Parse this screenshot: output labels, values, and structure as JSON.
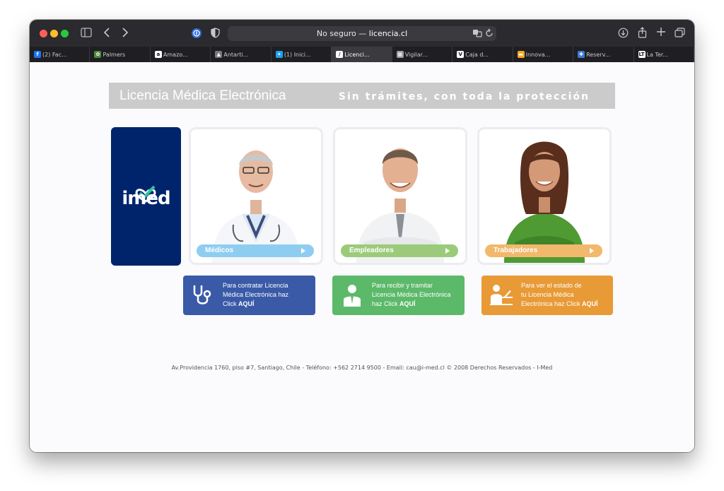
{
  "browser": {
    "address": {
      "prefix": "No seguro — ",
      "domain": "licencia.cl"
    },
    "tabs": [
      {
        "label": "(2) Fac...",
        "icon": "facebook-icon",
        "color": "#1877f2",
        "glyph": "f"
      },
      {
        "label": "Palmers",
        "icon": "palmers-icon",
        "color": "#4a8a3c",
        "glyph": "✿"
      },
      {
        "label": "Amazo...",
        "icon": "amazon-icon",
        "color": "#ffffff",
        "glyph": "a"
      },
      {
        "label": "Antarti...",
        "icon": "antartica-icon",
        "color": "#7a7a7a",
        "glyph": "▲"
      },
      {
        "label": "(1) Inici...",
        "icon": "twitter-icon",
        "color": "#1da1f2",
        "glyph": "✦"
      },
      {
        "label": "Licenci...",
        "icon": "licencia-icon",
        "color": "#ffffff",
        "glyph": "/"
      },
      {
        "label": "Vigilar...",
        "icon": "vigilar-icon",
        "color": "#9b9b9b",
        "glyph": "▦"
      },
      {
        "label": "Caja d...",
        "icon": "vimeo-icon",
        "color": "#ffffff",
        "glyph": "V"
      },
      {
        "label": "Innova...",
        "icon": "innova-icon",
        "color": "#f5a623",
        "glyph": "▬"
      },
      {
        "label": "Reserv...",
        "icon": "reserva-icon",
        "color": "#3b7bd6",
        "glyph": "✚"
      },
      {
        "label": "La Ter...",
        "icon": "laterc-icon",
        "color": "#ffffff",
        "glyph": "LT"
      }
    ],
    "active_tab": 5
  },
  "banner": {
    "title": "Licencia Médica Electrónica",
    "subtitle": "Sin trámites, con toda la protección"
  },
  "brand": {
    "name": "imed",
    "color": "#00246b"
  },
  "cards": [
    {
      "label": "Médicos",
      "color": "#8fcdf0"
    },
    {
      "label": "Empleadores",
      "color": "#9bcb7a"
    },
    {
      "label": "Trabajadores",
      "color": "#f2b86b"
    }
  ],
  "actions": [
    {
      "line1": "Para contratar Licencia",
      "line2": "Médica Electrónica haz",
      "line3": "Click ",
      "bold": "AQUÍ",
      "color": "#3a5aa8",
      "icon": "stethoscope-icon"
    },
    {
      "line1": "Para recibir y tramitar",
      "line2": "Licencia Médica Electrónica",
      "line3": "haz Click ",
      "bold": "AQUÍ",
      "color": "#5cb96a",
      "icon": "employer-icon"
    },
    {
      "line1": "Para ver el estado de",
      "line2": "tu Licencia Médica",
      "line3": "Electrónica haz Click ",
      "bold": "AQUÍ",
      "color": "#e89a36",
      "icon": "worker-laptop-icon"
    }
  ],
  "footer": {
    "text": "Av.Providencia 1760, piso #7, Santiago, Chile - Teléfono: +562 2714 9500 - Email: cau@i-med.cl © 2008 Derechos Reservados - I-Med"
  }
}
